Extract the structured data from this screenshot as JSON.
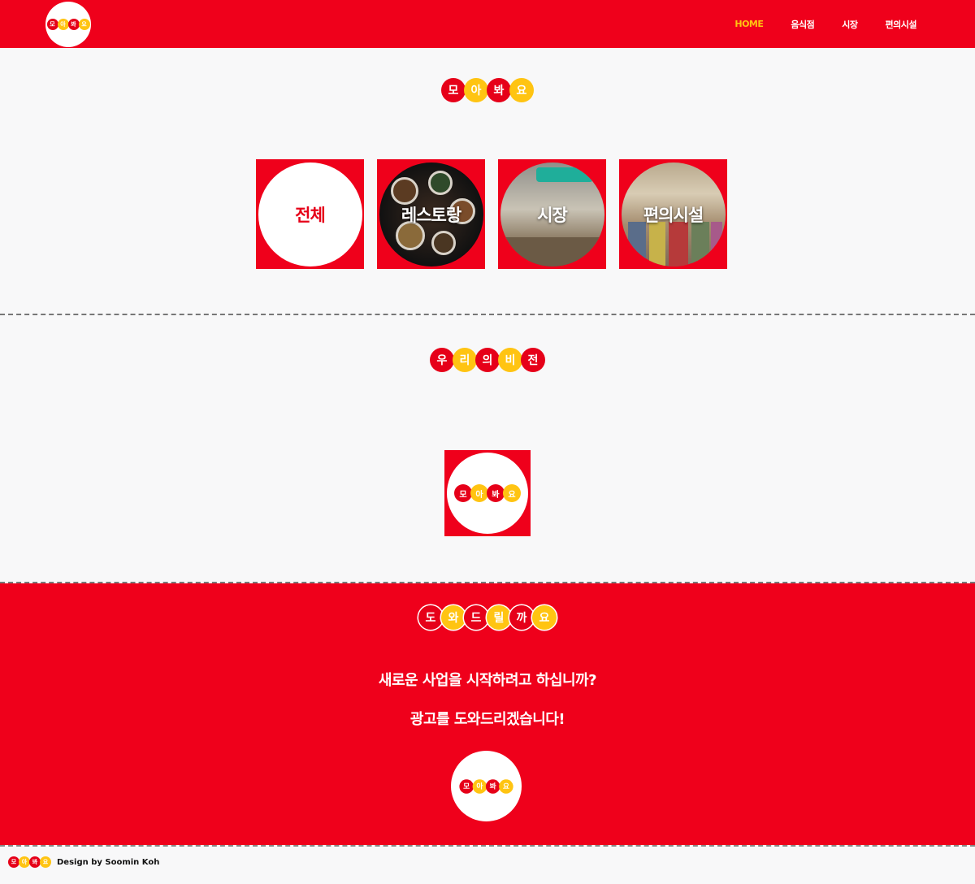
{
  "brand": {
    "letters": [
      "모",
      "아",
      "봐",
      "요"
    ],
    "colors": {
      "red": "#e60019",
      "yellow": "#ffc412",
      "header_bg": "#ef001b"
    }
  },
  "nav": {
    "items": [
      {
        "label": "HOME",
        "active": true
      },
      {
        "label": "음식점",
        "active": false
      },
      {
        "label": "시장",
        "active": false
      },
      {
        "label": "편의시설",
        "active": false
      }
    ]
  },
  "categories": {
    "title_letters": [
      "모",
      "아",
      "봐",
      "요"
    ],
    "cards": [
      {
        "label": "전체"
      },
      {
        "label": "레스토랑"
      },
      {
        "label": "시장"
      },
      {
        "label": "편의시설"
      }
    ]
  },
  "vision": {
    "title_letters": [
      "우",
      "리",
      "의",
      "비",
      "전"
    ]
  },
  "help": {
    "title_letters": [
      "도",
      "와",
      "드",
      "릴",
      "까",
      "요"
    ],
    "line1": "새로운 사업을 시작하려고 하십니까?",
    "line2": "광고를 도와드리겠습니다!"
  },
  "footer": {
    "credit": "Design by Soomin Koh"
  }
}
